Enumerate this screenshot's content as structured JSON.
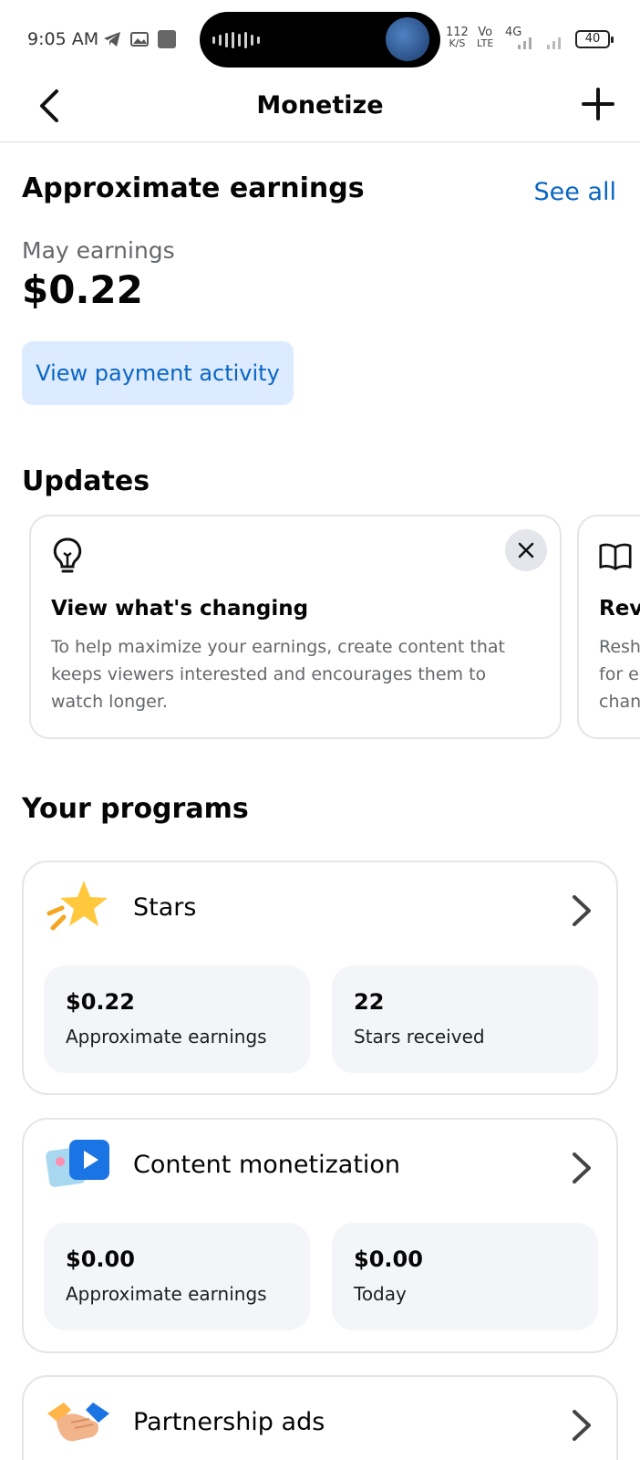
{
  "status_bar": {
    "time": "9:05 AM",
    "net_speed_value": "112",
    "net_speed_unit": "K/S",
    "volte_top": "Vo",
    "volte_bottom": "LTE",
    "network": "4G",
    "battery": "40"
  },
  "header": {
    "title": "Monetize",
    "back_icon": "chevron-left-icon",
    "add_icon": "plus-icon"
  },
  "earnings": {
    "title": "Approximate earnings",
    "see_all": "See all",
    "period_label": "May earnings",
    "amount": "$0.22",
    "payment_button": "View payment activity"
  },
  "updates": {
    "title": "Updates",
    "cards": [
      {
        "icon": "lightbulb-icon",
        "title": "View what's changing",
        "body": "To help maximize your earnings, create content that keeps viewers interested and encourages them to watch longer."
      },
      {
        "icon": "book-icon",
        "title": "Revi",
        "body": "Resh for e chan"
      }
    ]
  },
  "programs": {
    "title": "Your programs",
    "items": [
      {
        "name": "Stars",
        "icon": "star-icon",
        "stats": [
          {
            "value": "$0.22",
            "label": "Approximate earnings"
          },
          {
            "value": "22",
            "label": "Stars received"
          }
        ]
      },
      {
        "name": "Content monetization",
        "icon": "video-content-icon",
        "stats": [
          {
            "value": "$0.00",
            "label": "Approximate earnings"
          },
          {
            "value": "$0.00",
            "label": "Today"
          }
        ]
      },
      {
        "name": "Partnership ads",
        "icon": "handshake-icon"
      }
    ]
  },
  "colors": {
    "accent": "#0a66c2",
    "button_bg": "#dcebff",
    "secondary_text": "#65676b",
    "border": "#e3e5e8",
    "stat_bg": "#f3f5f8"
  }
}
